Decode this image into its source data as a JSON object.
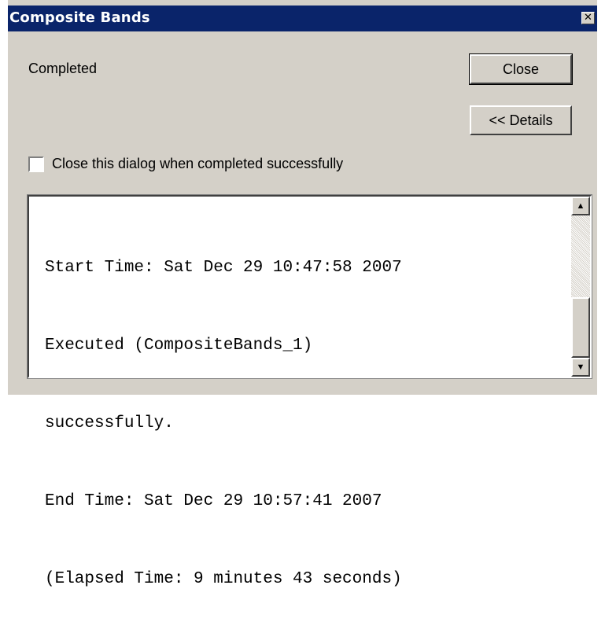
{
  "window": {
    "title": "Composite Bands",
    "close_glyph": "✕"
  },
  "status": {
    "text": "Completed"
  },
  "buttons": {
    "close_label": "Close",
    "details_label": "<< Details"
  },
  "checkbox": {
    "label": "Close this dialog when completed successfully",
    "checked": false
  },
  "log": {
    "lines": [
      "Start Time: Sat Dec 29 10:47:58 2007",
      "Executed (CompositeBands_1)",
      "successfully.",
      "End Time: Sat Dec 29 10:57:41 2007",
      "(Elapsed Time: 9 minutes 43 seconds)"
    ]
  },
  "scrollbar": {
    "up_glyph": "▲",
    "down_glyph": "▼"
  }
}
